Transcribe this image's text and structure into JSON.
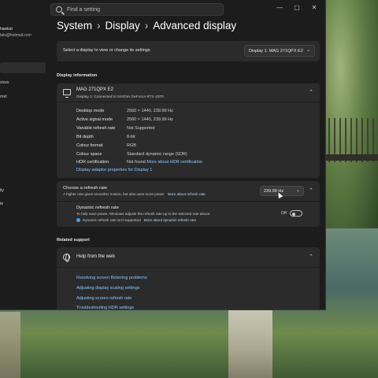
{
  "search": {
    "placeholder": "Find a setting"
  },
  "window_controls": {
    "minimize": "—",
    "maximize": "▢",
    "close": "✕"
  },
  "sidebar": {
    "user_name": "hawkat",
    "user_email": "tals@hotmail.com",
    "items": [
      "vices",
      "rnet",
      "ity",
      "te"
    ]
  },
  "breadcrumb": {
    "part1": "System",
    "part2": "Display",
    "part3": "Advanced display",
    "sep": "›"
  },
  "select_display": {
    "label": "Select a display to view or change its settings",
    "value": "Display 1: MAG 271QPX E2"
  },
  "display_info": {
    "section": "Display information",
    "name": "MAG 271QPX E2",
    "subtitle": "Display 1: Connected to NVIDIA GeForce RTX 4070",
    "rows": [
      {
        "key": "Desktop mode",
        "value": "2560 × 1440, 239.99 Hz"
      },
      {
        "key": "Active signal mode",
        "value": "2560 × 1440, 239.99 Hz"
      },
      {
        "key": "Variable refresh rate",
        "value": "Not Supported"
      },
      {
        "key": "Bit depth",
        "value": "8-bit"
      },
      {
        "key": "Colour format",
        "value": "RGB"
      },
      {
        "key": "Colour space",
        "value": "Standard dynamic range (SDR)"
      },
      {
        "key": "HDR certification",
        "value": "Not found",
        "link": "More about HDR certification"
      }
    ],
    "adaptor_link": "Display adaptor properties for Display 1"
  },
  "refresh": {
    "title": "Choose a refresh rate",
    "subtitle": "A higher rate gives smoother motion, but also uses more power",
    "link": "More about refresh rate",
    "value": "239.99 Hz",
    "dynamic_title": "Dynamic refresh rate",
    "dynamic_sub": "To help save power, Windows adjusts the refresh rate up to the selected rate above",
    "dynamic_warn": "Dynamic refresh rate isn't supported",
    "dynamic_link": "More about dynamic refresh rate",
    "toggle_label": "Off"
  },
  "related": {
    "section": "Related support",
    "help_title": "Help from the web",
    "links": [
      "Resolving screen flickering problems",
      "Adjusting display scaling settings",
      "Adjusting screen refresh rate",
      "Troubleshooting HDR settings"
    ]
  },
  "icons": {
    "chevron_down": "⌄",
    "chevron_up": "⌃"
  }
}
